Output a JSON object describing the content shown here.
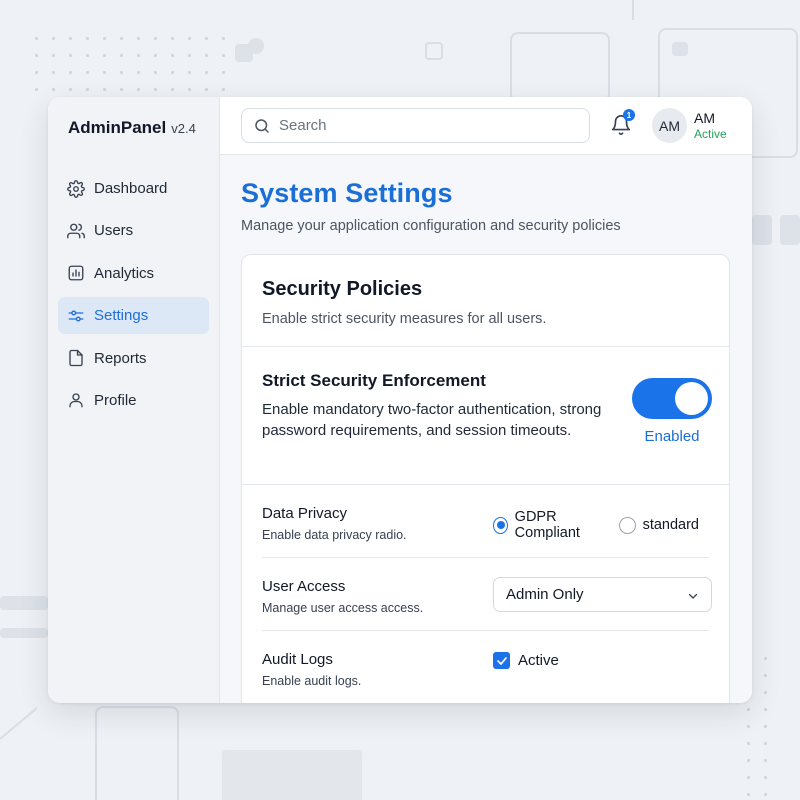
{
  "app": {
    "name": "AdminPanel",
    "version": "v2.4"
  },
  "sidebar": {
    "items": [
      {
        "label": "Dashboard",
        "icon": "gear-icon",
        "active": false
      },
      {
        "label": "Users",
        "icon": "users-icon",
        "active": false
      },
      {
        "label": "Analytics",
        "icon": "chart-icon",
        "active": false
      },
      {
        "label": "Settings",
        "icon": "sliders-icon",
        "active": true
      },
      {
        "label": "Reports",
        "icon": "document-icon",
        "active": false
      },
      {
        "label": "Profile",
        "icon": "user-icon",
        "active": false
      }
    ]
  },
  "header": {
    "search_placeholder": "Search",
    "notifications_count": "1",
    "avatar_initials": "AM",
    "user_name": "AM",
    "user_status": "Active"
  },
  "page": {
    "title": "System Settings",
    "subtitle": "Manage your application configuration and security policies"
  },
  "card": {
    "title": "Security Policies",
    "description": "Enable strict security measures for all users.",
    "strict": {
      "title": "Strict Security Enforcement",
      "description": "Enable mandatory two-factor authentication, strong password requirements, and session timeouts.",
      "toggle_on": true,
      "toggle_label": "Enabled"
    },
    "data_privacy": {
      "title": "Data Privacy",
      "description": "Enable data privacy radio.",
      "options": [
        "GDPR Compliant",
        "standard"
      ],
      "selected": "GDPR Compliant"
    },
    "user_access": {
      "title": "User Access",
      "description": "Manage user access access.",
      "value": "Admin Only"
    },
    "audit_logs": {
      "title": "Audit Logs",
      "description": "Enable audit logs.",
      "checked": true,
      "label": "Active"
    }
  },
  "colors": {
    "accent": "#1a73e8",
    "title": "#1a6fd6",
    "active_nav_bg": "#dde8f7",
    "status_green": "#22a35a"
  }
}
